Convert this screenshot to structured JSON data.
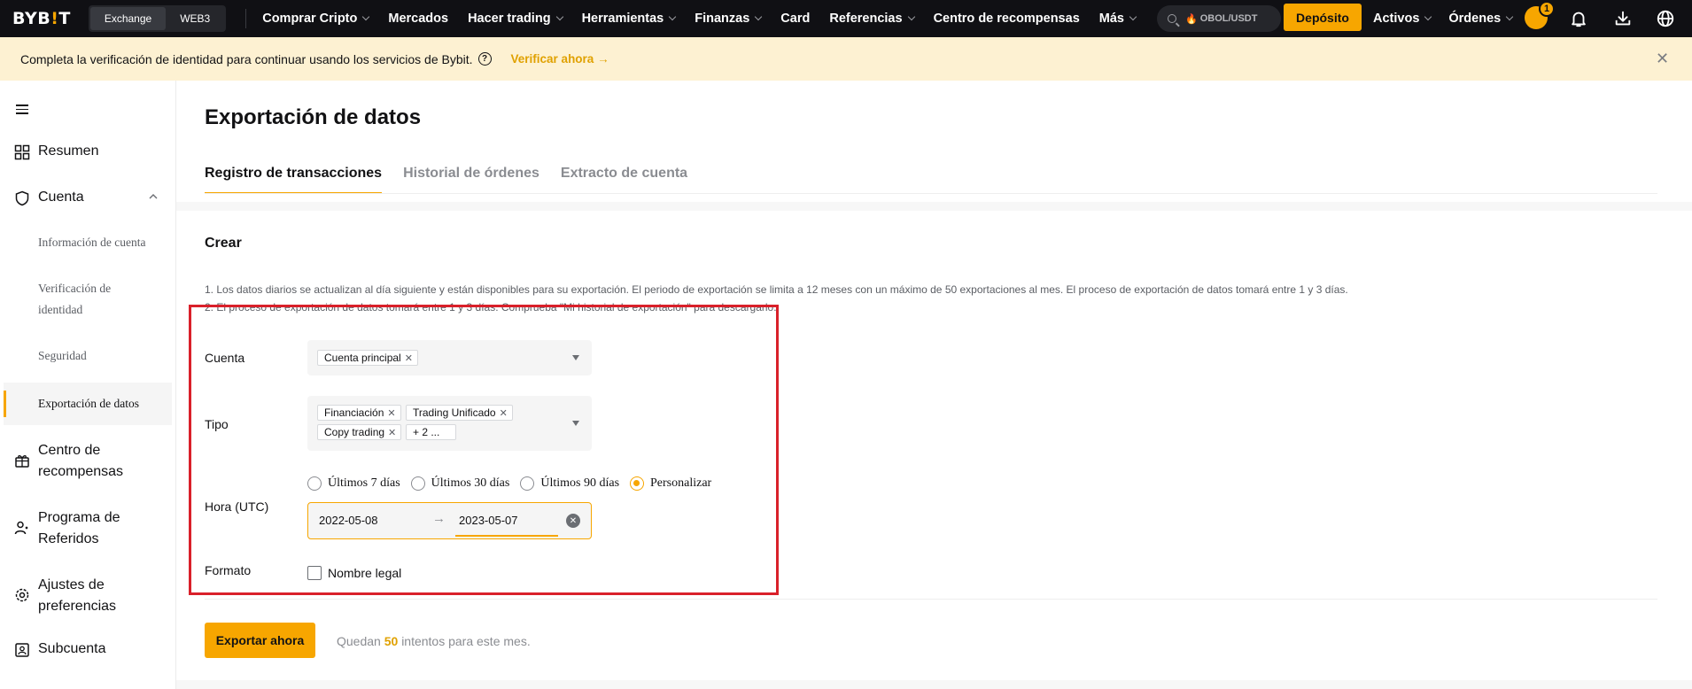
{
  "topnav": {
    "logo_prefix": "BYB",
    "logo_dot": "!",
    "logo_suffix": "T",
    "seg_exchange": "Exchange",
    "seg_web3": "WEB3",
    "items": [
      "Comprar Cripto",
      "Mercados",
      "Hacer trading",
      "Herramientas",
      "Finanzas",
      "Card",
      "Referencias",
      "Centro de recompensas",
      "Más"
    ],
    "search_text": "OBOL/USDT",
    "deposit": "Depósito",
    "activos": "Activos",
    "ordenes": "Órdenes",
    "avatar_badge": "1"
  },
  "banner": {
    "message": "Completa la verificación de identidad para continuar usando los servicios de Bybit.",
    "help": "?",
    "link": "Verificar ahora →",
    "close": "✕"
  },
  "sidebar": {
    "resumen": "Resumen",
    "cuenta": "Cuenta",
    "sub_info": "Información de cuenta",
    "sub_verif_1": "Verificación de",
    "sub_verif_2": "identidad",
    "sub_seguridad": "Seguridad",
    "sub_export": "Exportación de datos",
    "centro_1": "Centro de",
    "centro_2": "recompensas",
    "programa_1": "Programa de",
    "programa_2": "Referidos",
    "ajustes_1": "Ajustes de",
    "ajustes_2": "preferencias",
    "subcuenta": "Subcuenta"
  },
  "main": {
    "title": "Exportación de datos",
    "tabs": [
      "Registro de transacciones",
      "Historial de órdenes",
      "Extracto de cuenta"
    ],
    "section": "Crear",
    "note1": "1.   Los datos diarios se actualizan al día siguiente y están disponibles para su exportación. El periodo de exportación se limita a 12 meses con un máximo de 50 exportaciones al mes. El proceso de exportación de datos tomará entre 1 y 3 días.",
    "note2": "2.   El proceso de exportación de datos tomará entre 1 y 3 días. Comprueba \"Mi historial de exportación\" para descargarlo.",
    "cuenta_label": "Cuenta",
    "cuenta_tag": "Cuenta principal",
    "tipo_label": "Tipo",
    "tipo_tags": [
      "Financiación",
      "Trading Unificado",
      "Copy trading",
      "+ 2 ..."
    ],
    "hora_label": "Hora (UTC)",
    "radios": [
      "Últimos 7 días",
      "Últimos 30 días",
      "Últimos 90 días",
      "Personalizar"
    ],
    "date_from": "2022-05-08",
    "date_arrow": "→",
    "date_to": "2023-05-07",
    "formato_label": "Formato",
    "checkbox_label": "Nombre legal",
    "export_button": "Exportar ahora",
    "remain_prefix": "Quedan",
    "remain_num": "50",
    "remain_suffix": "intentos para este mes."
  }
}
